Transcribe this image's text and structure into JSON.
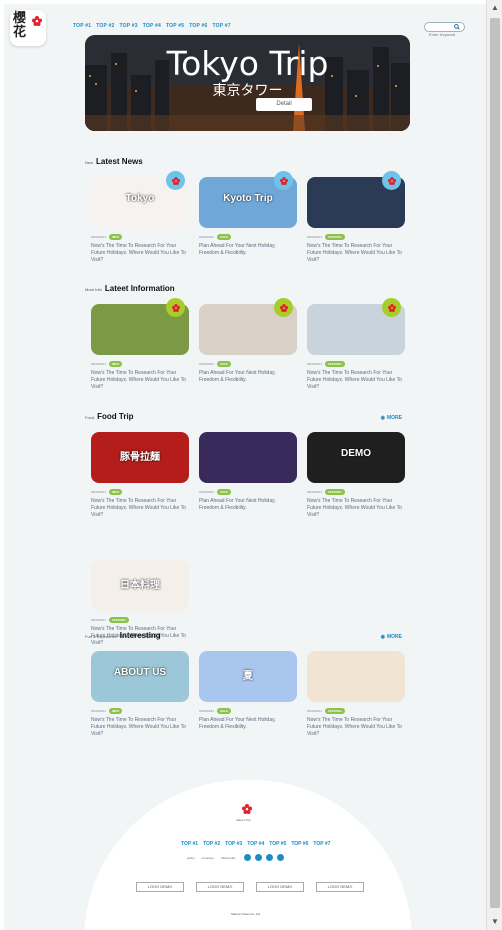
{
  "logo": {
    "text": "櫻花"
  },
  "topnav": [
    "TOP #1",
    "TOP #2",
    "TOP #3",
    "TOP #4",
    "TOP #5",
    "TOP #6",
    "TOP #7"
  ],
  "search": {
    "placeholder": "Enter Keywords"
  },
  "hero": {
    "title": "Tokyo Trip",
    "subtitle": "東京タワー",
    "button": "Detail"
  },
  "sections": [
    {
      "small": "New",
      "title": "Latest News",
      "more": "",
      "cards": [
        {
          "image": "Tokyo sakura",
          "image_text": "Tokyo",
          "date": "03/09/2021",
          "tag": "INFO",
          "text": "Now's The Time To Research For Your Future Holidays. Where Would You Like To Visit?"
        },
        {
          "image": "Kyoto mountain",
          "image_text": "Kyoto Trip",
          "date": "03/09/2021",
          "tag": "SALE",
          "text": "Plan Ahead For Your Next Holiday, Freedom & Flexibility."
        },
        {
          "image": "Tokyo night",
          "image_text": "",
          "date": "03/09/2021",
          "tag": "FESTIVAL",
          "text": "Now's The Time To Research For Your Future Holidays. Where Would You Like To Visit?"
        }
      ]
    },
    {
      "small": "More Info",
      "title": "Lateet Information",
      "more": "",
      "cards": [
        {
          "image": "golden temple",
          "image_text": "",
          "date": "03/09/2021",
          "tag": "INFO",
          "text": "Now's The Time To Research For Your Future Holidays. Where Would You Like To Visit?"
        },
        {
          "image": "shrine gate",
          "image_text": "",
          "date": "03/09/2021",
          "tag": "SALE",
          "text": "Plan Ahead For Your Next Holiday, Freedom & Flexibility."
        },
        {
          "image": "snow torii",
          "image_text": "",
          "date": "03/09/2021",
          "tag": "FESTIVAL",
          "text": "Now's The Time To Research For Your Future Holidays. Where Would You Like To Visit?"
        }
      ]
    },
    {
      "small": "Food",
      "title": "Food Trip",
      "more": "MORE",
      "cards": [
        {
          "image": "ramen poster",
          "image_text": "豚骨拉麺",
          "date": "03/09/2021",
          "tag": "INFO",
          "text": "Now's The Time To Research For Your Future Holidays. Where Would You Like To Visit?"
        },
        {
          "image": "shibuya street",
          "image_text": "",
          "date": "03/09/2021",
          "tag": "SALE",
          "text": "Plan Ahead For Your Next Holiday, Freedom & Flexibility."
        },
        {
          "image": "oyster dish",
          "image_text": "DEMO",
          "date": "03/09/2021",
          "tag": "FESTIVAL",
          "text": "Now's The Time To Research For Your Future Holidays. Where Would You Like To Visit?"
        },
        {
          "image": "sushi",
          "image_text": "日本料理",
          "date": "03/09/2021",
          "tag": "FESTIVAL",
          "text": "Now's The Time To Research For Your Future Holidays. Where Would You Like To Visit?"
        }
      ]
    },
    {
      "small": "Fun & Experience",
      "title": "Interesting",
      "more": "MORE",
      "cards": [
        {
          "image": "about us",
          "image_text": "ABOUT US",
          "date": "03/09/2021",
          "tag": "INFO",
          "text": "Now's The Time To Research For Your Future Holidays. Where Would You Like To Visit?"
        },
        {
          "image": "summer sky",
          "image_text": "夏",
          "date": "03/09/2021",
          "tag": "SALE",
          "text": "Plan Ahead For Your Next Holiday, Freedom & Flexibility."
        },
        {
          "image": "japanese art",
          "image_text": "",
          "date": "03/09/2021",
          "tag": "FESTIVAL",
          "text": "Now's The Time To Research For Your Future Holidays. Where Would You Like To Visit?"
        }
      ]
    }
  ],
  "footer": {
    "logo_text": "sakura Trip",
    "nav": [
      "TOP #1",
      "TOP #2",
      "TOP #3",
      "TOP #4",
      "TOP #5",
      "TOP #6",
      "TOP #7"
    ],
    "links": [
      "policy",
      "company",
      "follow links"
    ],
    "logos": [
      "LOGO DEMO",
      "LOGO DEMO",
      "LOGO DEMO",
      "LOGO DEMO"
    ],
    "copyright": "Sakura Travel Co. Ltd."
  },
  "colors": {
    "accent": "#1b8cc4",
    "tag": "#8bc34a",
    "badge_blue": "#6fc3e8",
    "badge_green": "#a6cd2a",
    "flower": "#e3232b"
  }
}
